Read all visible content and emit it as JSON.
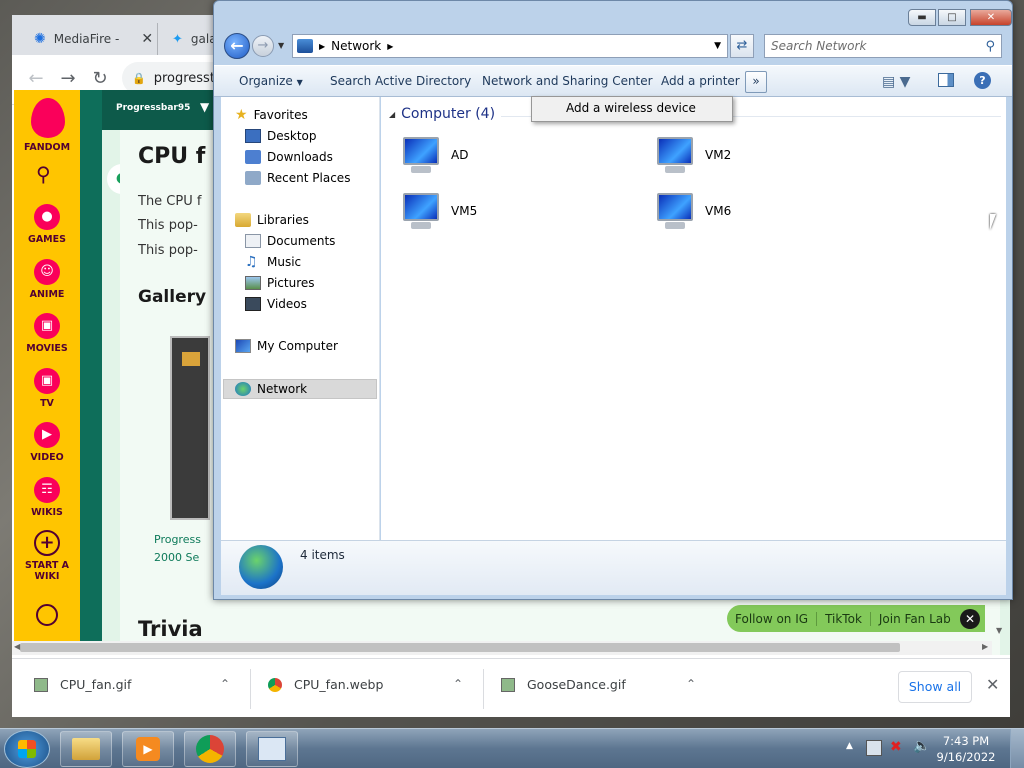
{
  "browser": {
    "tabs": [
      {
        "label": "MediaFire -",
        "icon": "mediafire-icon"
      },
      {
        "label": "galax",
        "icon": "twitter-icon"
      }
    ],
    "address": "progresst"
  },
  "fandom": {
    "logo_label": "FANDOM",
    "nav": [
      {
        "label": "GAMES",
        "icon": "games-icon"
      },
      {
        "label": "ANIME",
        "icon": "anime-icon"
      },
      {
        "label": "MOVIES",
        "icon": "movies-icon"
      },
      {
        "label": "TV",
        "icon": "tv-icon"
      },
      {
        "label": "VIDEO",
        "icon": "video-icon"
      },
      {
        "label": "WIKIS",
        "icon": "wikis-icon"
      },
      {
        "label": "START A WIKI",
        "icon": "plus-icon"
      }
    ]
  },
  "page": {
    "site_name": "Progressbar95",
    "heading": "CPU f",
    "para": [
      "The CPU f",
      "This pop-",
      "This pop-"
    ],
    "gallery_heading": "Gallery",
    "caption_line1": "Progress",
    "caption_line2": "2000 Se",
    "trivia_heading": "Trivia"
  },
  "follow_bar": {
    "items": [
      "Follow on IG",
      "TikTok",
      "Join Fan Lab"
    ]
  },
  "explorer": {
    "breadcrumb": "Network",
    "search_placeholder": "Search Network",
    "commands": [
      "Organize",
      "Search Active Directory",
      "Network and Sharing Center",
      "Add a printer"
    ],
    "overflow_item": "Add a wireless device",
    "nav": {
      "favorites_label": "Favorites",
      "favorites": [
        "Desktop",
        "Downloads",
        "Recent Places"
      ],
      "libraries_label": "Libraries",
      "libraries": [
        "Documents",
        "Music",
        "Pictures",
        "Videos"
      ],
      "computer_label": "My Computer",
      "network_label": "Network"
    },
    "group_header": "Computer (4)",
    "computers": [
      "AD",
      "VM2",
      "VM5",
      "VM6"
    ],
    "status_text": "4 items"
  },
  "downloads": {
    "items": [
      {
        "name": "CPU_fan.gif",
        "icon": "image-file-icon"
      },
      {
        "name": "CPU_fan.webp",
        "icon": "chrome-file-icon"
      },
      {
        "name": "GooseDance.gif",
        "icon": "image-file-icon"
      }
    ],
    "show_all": "Show all"
  },
  "taskbar": {
    "time": "7:43 PM",
    "date": "9/16/2022"
  }
}
